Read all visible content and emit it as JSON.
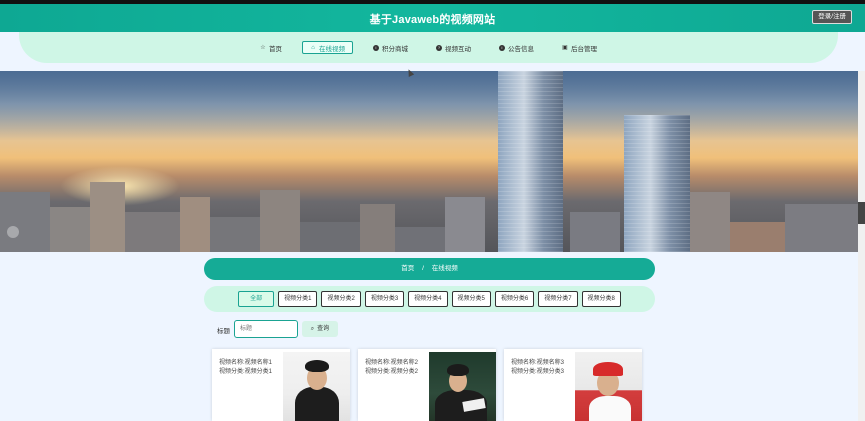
{
  "header": {
    "title": "基于Javaweb的视频网站",
    "login_button": "登录/注册"
  },
  "nav": {
    "items": [
      {
        "label": "首页",
        "icon": "star-icon"
      },
      {
        "label": "在线视频",
        "icon": "bag-icon",
        "active": true
      },
      {
        "label": "积分商城",
        "icon": "info-circle-icon"
      },
      {
        "label": "视频互动",
        "icon": "help-circle-icon"
      },
      {
        "label": "公告信息",
        "icon": "info-circle-icon"
      },
      {
        "label": "后台管理",
        "icon": "gift-icon"
      }
    ]
  },
  "banner": {
    "slide_count": 3,
    "active_slide": 1
  },
  "breadcrumb": {
    "home": "首页",
    "separator": "/",
    "current": "在线视频"
  },
  "categories": {
    "items": [
      "全部",
      "视频分类1",
      "视频分类2",
      "视频分类3",
      "视频分类4",
      "视频分类5",
      "视频分类6",
      "视频分类7",
      "视频分类8"
    ],
    "active_index": 0
  },
  "search": {
    "label": "标题",
    "placeholder": "标题",
    "button": "查询"
  },
  "videos": [
    {
      "name_line": "视频名称:视频名称1",
      "category_line": "视频分类:视频分类1"
    },
    {
      "name_line": "视频名称:视频名称2",
      "category_line": "视频分类:视频分类2"
    },
    {
      "name_line": "视频名称:视频名称3",
      "category_line": "视频分类:视频分类3"
    }
  ],
  "colors": {
    "brand_green": "#15ab96",
    "nav_bg": "#cff6e6",
    "page_bg": "#eef5ff"
  }
}
